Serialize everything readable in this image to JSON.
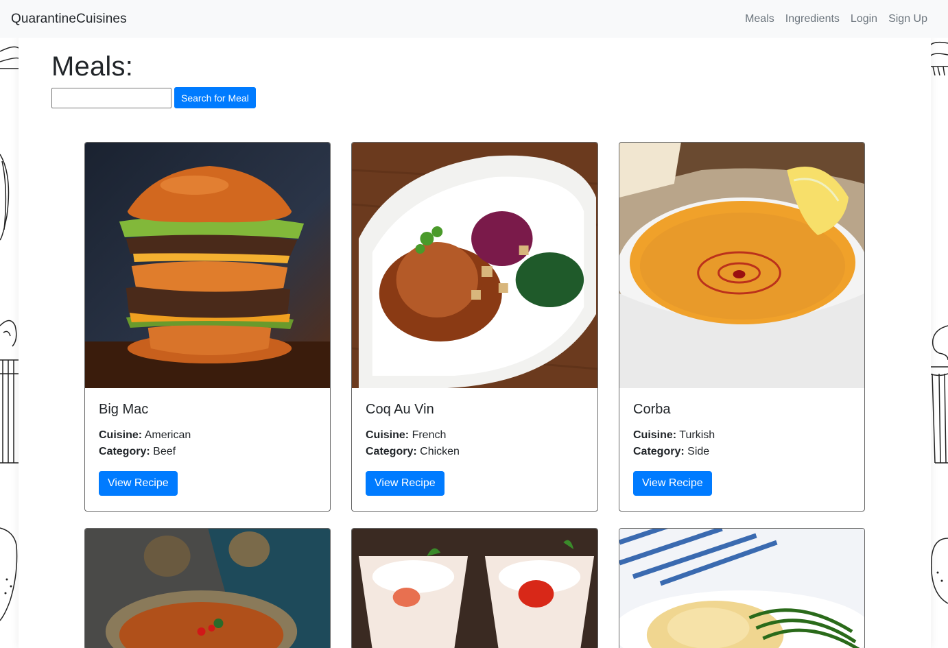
{
  "navbar": {
    "brand": "QuarantineCuisines",
    "links": [
      "Meals",
      "Ingredients",
      "Login",
      "Sign Up"
    ]
  },
  "page": {
    "title": "Meals:",
    "search": {
      "value": "",
      "button_label": "Search for Meal"
    }
  },
  "labels": {
    "cuisine": "Cuisine:",
    "category": "Category:",
    "view_recipe": "View Recipe"
  },
  "meals": [
    {
      "name": "Big Mac",
      "cuisine": "American",
      "category": "Beef",
      "image": "burger-photo"
    },
    {
      "name": "Coq Au Vin",
      "cuisine": "French",
      "category": "Chicken",
      "image": "chicken-plate-photo"
    },
    {
      "name": "Corba",
      "cuisine": "Turkish",
      "category": "Side",
      "image": "soup-bowl-photo"
    }
  ],
  "partial_row_images": [
    "lentil-stew-photo",
    "dessert-glasses-photo",
    "fish-pie-photo"
  ],
  "colors": {
    "primary": "#007bff",
    "navbar_bg": "#f8f9fa",
    "nav_link": "#6c757d"
  }
}
